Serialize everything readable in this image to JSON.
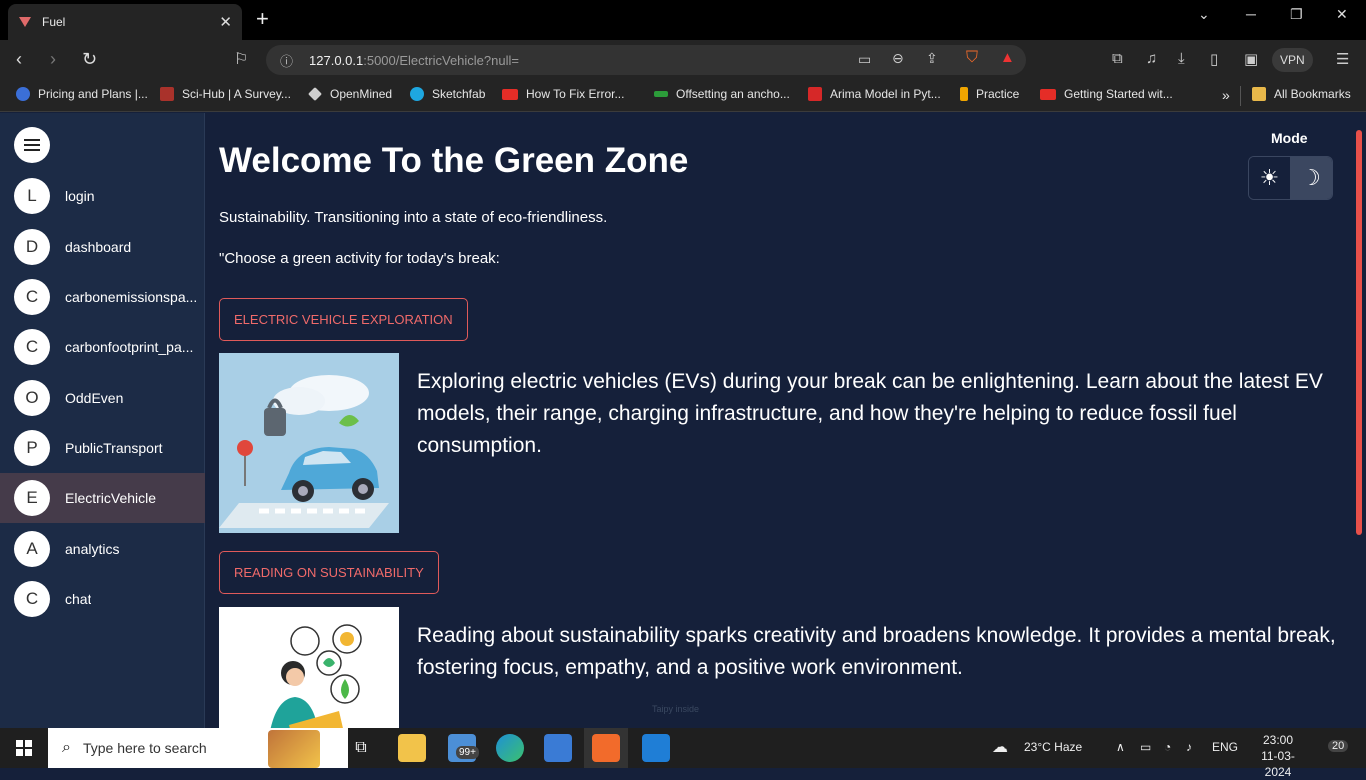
{
  "browser": {
    "tab_title": "Fuel",
    "tab_close": "✕",
    "new_tab": "+",
    "url_host": "127.0.0.1",
    "url_path": ":5000/ElectricVehicle?null=",
    "vpn_label": "VPN",
    "bookmarks": [
      {
        "label": "Pricing and Plans |...",
        "color": "#3b6fd8"
      },
      {
        "label": "Sci-Hub | A Survey...",
        "color": "#a9322b"
      },
      {
        "label": "OpenMined",
        "color": "#cfcfcf"
      },
      {
        "label": "Sketchfab",
        "color": "#1ea7e0"
      },
      {
        "label": "How To Fix Error...",
        "color": "#e52d27"
      },
      {
        "label": "Offsetting an ancho...",
        "color": "#2c9c3a"
      },
      {
        "label": "Arima Model in Pyt...",
        "color": "#d62828"
      },
      {
        "label": "Practice",
        "color": "#f0a500"
      },
      {
        "label": "Getting Started wit...",
        "color": "#e52d27"
      }
    ],
    "more_bookmarks": "»",
    "all_bookmarks": "All Bookmarks"
  },
  "sidebar": {
    "items": [
      {
        "initial": "L",
        "label": "login"
      },
      {
        "initial": "D",
        "label": "dashboard"
      },
      {
        "initial": "C",
        "label": "carbonemissionspa..."
      },
      {
        "initial": "C",
        "label": "carbonfootprint_pa..."
      },
      {
        "initial": "O",
        "label": "OddEven"
      },
      {
        "initial": "P",
        "label": "PublicTransport"
      },
      {
        "initial": "E",
        "label": "ElectricVehicle"
      },
      {
        "initial": "A",
        "label": "analytics"
      },
      {
        "initial": "C",
        "label": "chat"
      }
    ],
    "active_index": 6
  },
  "main": {
    "title": "Welcome To the Green Zone",
    "subtitle": "Sustainability. Transitioning into a state of eco-friendliness.",
    "prompt": "\"Choose a green activity for today's break:",
    "mode_label": "Mode",
    "activities": [
      {
        "button": "ELECTRIC VEHICLE EXPLORATION",
        "description": "Exploring electric vehicles (EVs) during your break can be enlightening. Learn about the latest EV models, their range, charging infrastructure, and how they're helping to reduce fossil fuel consumption."
      },
      {
        "button": "READING ON SUSTAINABILITY",
        "description": "Reading about sustainability sparks creativity and broadens knowledge. It provides a mental break, fostering focus, empathy, and a positive work environment."
      }
    ],
    "watermark": "Taipy inside"
  },
  "taskbar": {
    "search_placeholder": "Type here to search",
    "mail_badge": "99+",
    "weather": "23°C  Haze",
    "language": "ENG",
    "time": "23:00",
    "date": "11-03-2024",
    "notifications": "20"
  },
  "colors": {
    "background": "#15203a",
    "sidebar": "#1c2b46",
    "active_item": "#453b4a",
    "accent": "#e05a5a"
  }
}
